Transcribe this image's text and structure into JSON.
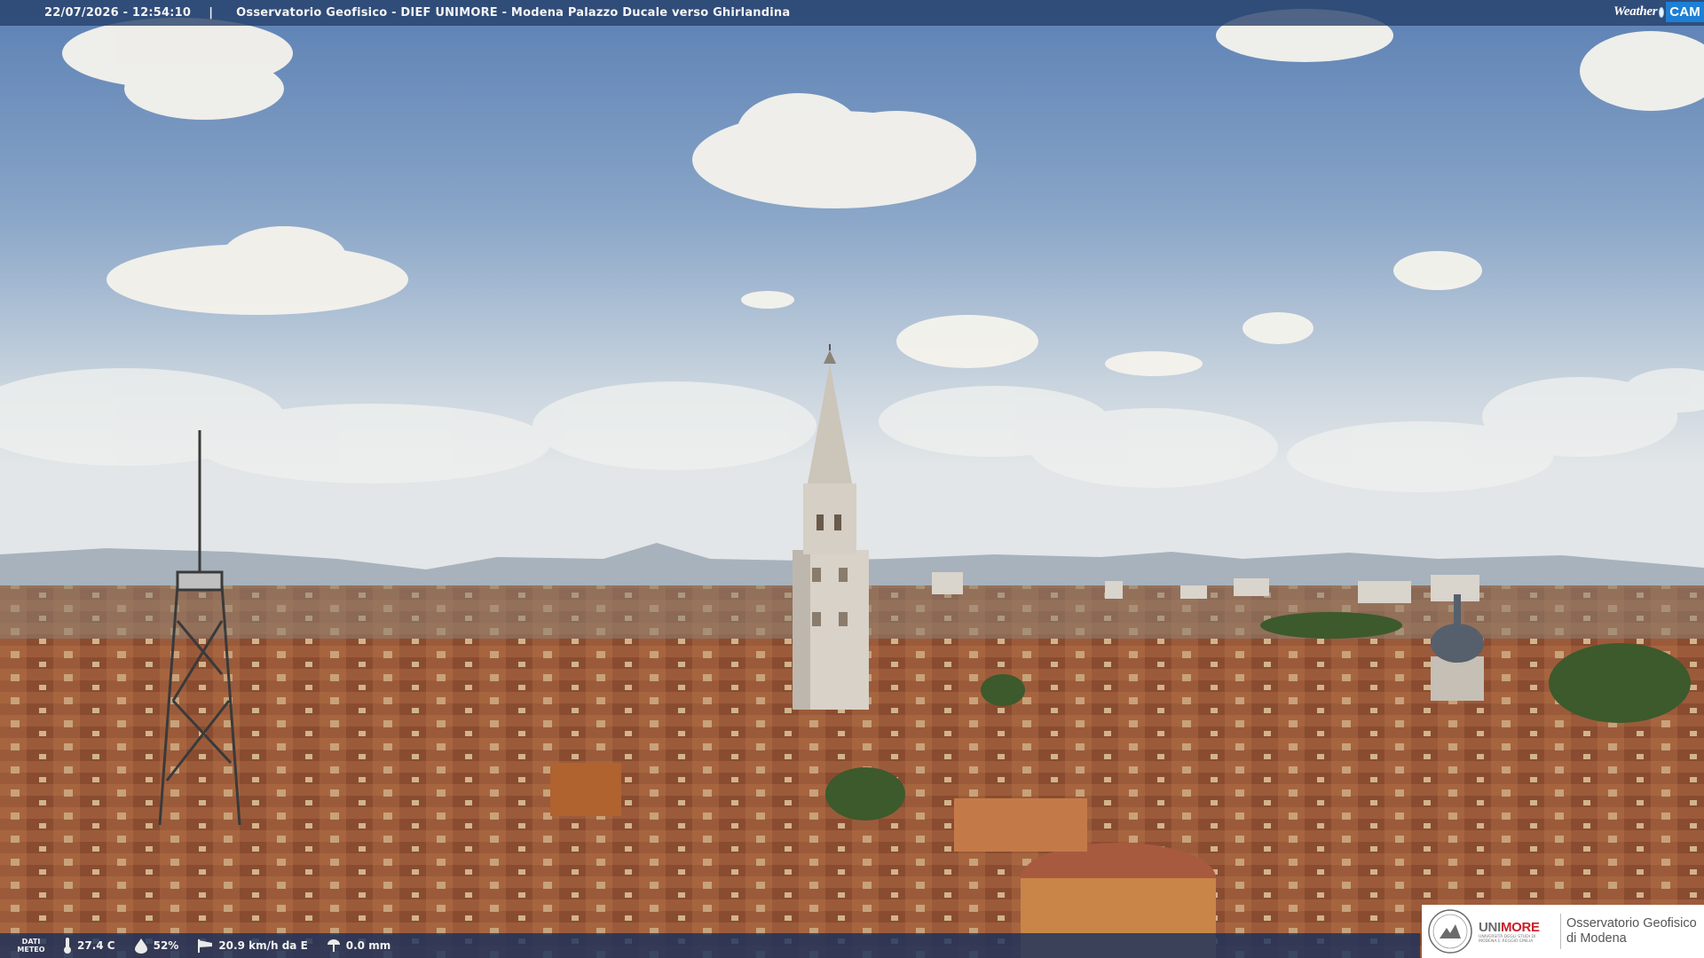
{
  "header": {
    "timestamp": "22/07/2026 - 12:54:10",
    "separator": "|",
    "title": "Osservatorio Geofisico - DIEF UNIMORE - Modena Palazzo Ducale verso Ghirlandina"
  },
  "weathercam_logo": {
    "word1": "Weather",
    "word2": "CAM"
  },
  "meteo": {
    "label_line1": "DATI",
    "label_line2": "METEO",
    "temperature": "27.4 C",
    "humidity": "52%",
    "wind": "20.9 km/h da E",
    "rain": "0.0 mm",
    "icons": [
      "thermometer-icon",
      "humidity-drop-icon",
      "wind-sock-icon",
      "rain-gauge-icon"
    ]
  },
  "unimore": {
    "brand_uni": "UNI",
    "brand_more": "MORE",
    "brand_sub_1": "UNIVERSITÀ DEGLI STUDI DI",
    "brand_sub_2": "MODENA E REGGIO EMILIA",
    "observatory_line1": "Osservatorio Geofisico",
    "observatory_line2": "di Modena"
  },
  "colors": {
    "sky_top": "#5a80b3",
    "sky_horizon": "#dfe5e8",
    "roof_terracotta": "#9a5a3c",
    "cam_blue": "#1e7fd4",
    "unimore_red": "#c8202a"
  }
}
